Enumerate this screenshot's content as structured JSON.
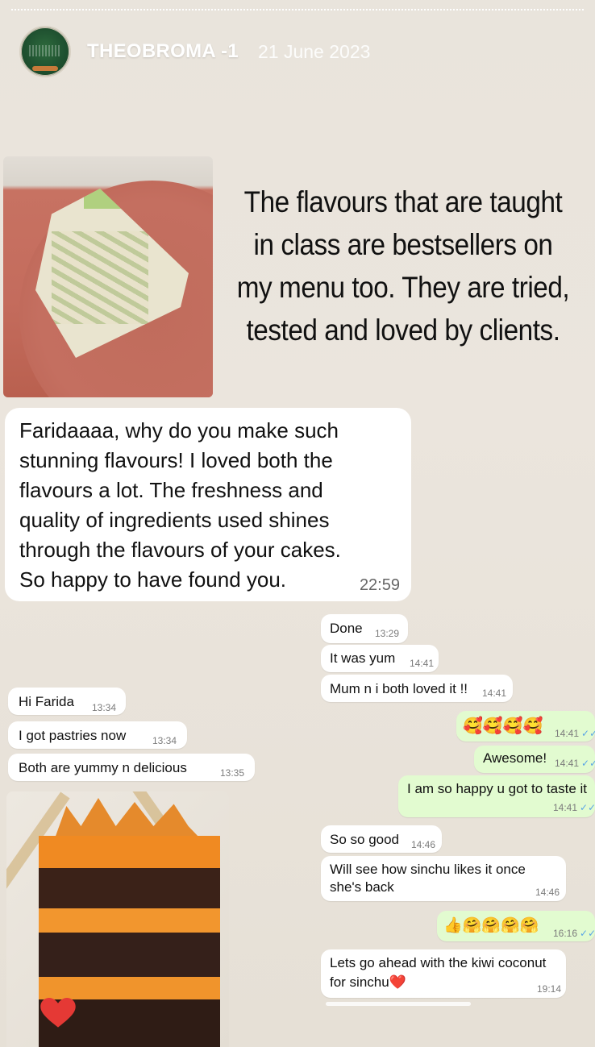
{
  "story": {
    "account": "THEOBROMA -1",
    "date": "21 June 2023"
  },
  "caption": {
    "line1": "The flavours that are taught",
    "line2": "in class are bestsellers on",
    "line3": "my menu too. They are tried,",
    "line4": "tested and loved by clients."
  },
  "review": {
    "lines": [
      "Faridaaaa, why do you make such",
      "stunning flavours! I loved both the",
      "flavours a lot. The freshness and",
      "quality of ingredients used shines",
      "through the flavours of your cakes.",
      "So happy to have found you."
    ],
    "time": "22:59"
  },
  "chat_left": [
    {
      "text": "Hi Farida",
      "time": "13:34"
    },
    {
      "text": "I got pastries now",
      "time": "13:34"
    },
    {
      "text": "Both are yummy n delicious",
      "time": "13:35"
    }
  ],
  "chat_right": {
    "m1": {
      "text": "Done",
      "time": "13:29"
    },
    "m2": {
      "text": "It was yum",
      "time": "14:41"
    },
    "m3": {
      "text": "Mum n i both loved it !!",
      "time": "14:41"
    },
    "m4": {
      "text": "🥰🥰🥰🥰",
      "time": "14:41"
    },
    "m5": {
      "text": "Awesome!",
      "time": "14:41"
    },
    "m6": {
      "text": "I am so happy u got to taste it",
      "time": "14:41"
    },
    "m7": {
      "text": "So so good",
      "time": "14:46"
    },
    "m8": {
      "line1": "Will see how sinchu likes it once",
      "line2": "she's back",
      "time": "14:46"
    },
    "m9": {
      "text": "👍🤗🤗🤗🤗",
      "time": "16:16"
    },
    "m10": {
      "line1": "Lets go ahead with the kiwi coconut",
      "line2": "for sinchu❤️",
      "time": "19:14"
    }
  },
  "ticks": "✓✓",
  "colors": {
    "background": "#e9e4dc",
    "incoming_bubble": "#ffffff",
    "outgoing_bubble": "#e2fbd0",
    "read_ticks": "#5aa5e6",
    "heart": "#e53935"
  },
  "icons": [
    "avatar",
    "heart-icon"
  ]
}
